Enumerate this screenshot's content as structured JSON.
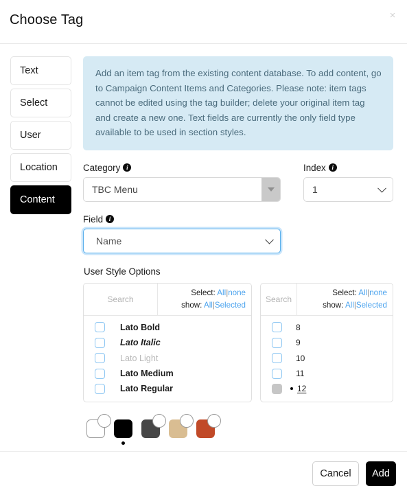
{
  "header": {
    "title": "Choose Tag",
    "close_label": "×"
  },
  "tabs": [
    {
      "label": "Text"
    },
    {
      "label": "Select"
    },
    {
      "label": "User"
    },
    {
      "label": "Location"
    },
    {
      "label": "Content"
    }
  ],
  "active_tab": "Content",
  "info_box": {
    "text": "Add an item tag from the existing content database. To add content, go to Campaign Content Items and Categories. Please note: item tags cannot be edited using the tag builder; delete your original item tag and create a new one. Text fields are currently the only field type available to be used in section styles.",
    "background": "#d6eaf4",
    "text_color": "#4a6b7c"
  },
  "category": {
    "label": "Category",
    "value": "TBC Menu",
    "info_icon": "info-icon"
  },
  "index": {
    "label": "Index",
    "value": "1",
    "info_icon": "info-icon"
  },
  "field": {
    "label": "Field",
    "value": "Name",
    "info_icon": "info-icon",
    "focus_color": "#5bb0ec"
  },
  "user_style_options": {
    "title": "User Style Options",
    "font_panel": {
      "search_placeholder": "Search",
      "select_label": "Select:",
      "select_all": "All",
      "select_none": "none",
      "show_label": "show:",
      "show_all": "All",
      "show_selected": "Selected",
      "separator": "|",
      "options": [
        {
          "label": "Lato Bold",
          "style": "f-bold",
          "checked": false
        },
        {
          "label": "Lato Italic",
          "style": "f-italic",
          "checked": false
        },
        {
          "label": "Lato Light",
          "style": "f-light",
          "checked": false
        },
        {
          "label": "Lato Medium",
          "style": "f-medium",
          "checked": false
        },
        {
          "label": "Lato Regular",
          "style": "f-regular",
          "checked": false
        }
      ]
    },
    "size_panel": {
      "search_placeholder": "Search",
      "select_label": "Select:",
      "select_all": "All",
      "select_none": "none",
      "show_label": "show:",
      "show_all": "All",
      "show_selected": "Selected",
      "separator": "|",
      "options": [
        {
          "label": "8",
          "checked": false,
          "marked": false
        },
        {
          "label": "9",
          "checked": false,
          "marked": false
        },
        {
          "label": "10",
          "checked": false,
          "marked": false
        },
        {
          "label": "11",
          "checked": false,
          "marked": false
        },
        {
          "label": "12",
          "checked": true,
          "marked": true
        }
      ]
    },
    "colors": [
      {
        "name": "white",
        "hex": "#ffffff",
        "selected": false,
        "outlined": true
      },
      {
        "name": "black",
        "hex": "#000000",
        "selected": true,
        "outlined": false
      },
      {
        "name": "dark-grey",
        "hex": "#474747",
        "selected": false,
        "outlined": false
      },
      {
        "name": "tan",
        "hex": "#d9bd92",
        "selected": false,
        "outlined": false
      },
      {
        "name": "orange-red",
        "hex": "#c14a28",
        "selected": false,
        "outlined": false
      }
    ]
  },
  "footer": {
    "cancel_label": "Cancel",
    "add_label": "Add"
  }
}
